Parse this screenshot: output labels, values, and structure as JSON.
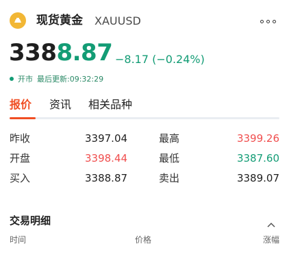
{
  "header": {
    "asset_name": "现货黄金",
    "symbol": "XAUUSD",
    "icon": "gold-bar-icon",
    "more_icon": "more-icon"
  },
  "price": {
    "integer_part": "338",
    "fraction_part": "8.87",
    "change": "−8.17 (−0.24%)"
  },
  "status": {
    "market_status": "开市",
    "last_update": "最后更新:09:32:29"
  },
  "tabs": [
    {
      "label": "报价",
      "active": true
    },
    {
      "label": "资讯",
      "active": false
    },
    {
      "label": "相关品种",
      "active": false
    }
  ],
  "quotes": {
    "prev_close": {
      "label": "昨收",
      "value": "3397.04"
    },
    "open": {
      "label": "开盘",
      "value": "3398.44"
    },
    "buy": {
      "label": "买入",
      "value": "3388.87"
    },
    "high": {
      "label": "最高",
      "value": "3399.26"
    },
    "low": {
      "label": "最低",
      "value": "3387.60"
    },
    "sell": {
      "label": "卖出",
      "value": "3389.07"
    }
  },
  "trade_details": {
    "title": "交易明细",
    "columns": [
      "时间",
      "价格",
      "涨幅"
    ]
  },
  "colors": {
    "accent_orange": "#f04e23",
    "up_red": "#f04e4e",
    "down_green": "#139c75",
    "gold_icon_bg": "#f2b735"
  }
}
